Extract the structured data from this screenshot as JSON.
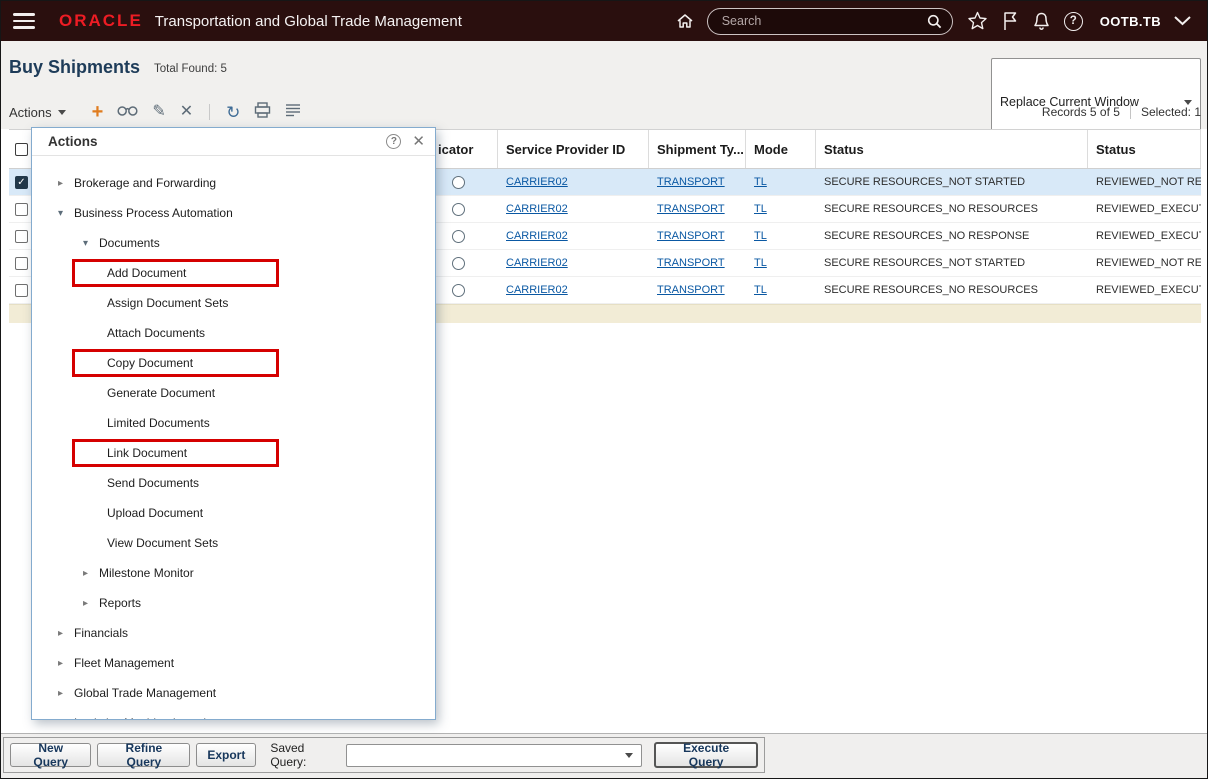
{
  "topbar": {
    "brand": "ORACLE",
    "app_title": "Transportation and Global Trade Management",
    "search_placeholder": "Search",
    "user": "OOTB.TB"
  },
  "page": {
    "title": "Buy Shipments",
    "total_found": "Total Found: 5",
    "window_select_value": "Replace Current Window"
  },
  "toolbar": {
    "actions_label": "Actions",
    "records_text": "Records 5 of 5",
    "selected_text": "Selected: 1"
  },
  "table": {
    "columns": [
      "",
      "icator",
      "Service Provider ID",
      "Shipment Ty...",
      "Mode",
      "Status",
      "Status"
    ],
    "rows": [
      {
        "selected": true,
        "service_provider_id": "CARRIER02",
        "shipment_type": "TRANSPORT",
        "mode": "TL",
        "status": "SECURE RESOURCES_NOT STARTED",
        "status2": "REVIEWED_NOT REV"
      },
      {
        "selected": false,
        "service_provider_id": "CARRIER02",
        "shipment_type": "TRANSPORT",
        "mode": "TL",
        "status": "SECURE RESOURCES_NO RESOURCES",
        "status2": "REVIEWED_EXECUTE"
      },
      {
        "selected": false,
        "service_provider_id": "CARRIER02",
        "shipment_type": "TRANSPORT",
        "mode": "TL",
        "status": "SECURE RESOURCES_NO RESPONSE",
        "status2": "REVIEWED_EXECUTE"
      },
      {
        "selected": false,
        "service_provider_id": "CARRIER02",
        "shipment_type": "TRANSPORT",
        "mode": "TL",
        "status": "SECURE RESOURCES_NOT STARTED",
        "status2": "REVIEWED_NOT REV"
      },
      {
        "selected": false,
        "service_provider_id": "CARRIER02",
        "shipment_type": "TRANSPORT",
        "mode": "TL",
        "status": "SECURE RESOURCES_NO RESOURCES",
        "status2": "REVIEWED_EXECUTE"
      }
    ]
  },
  "actions_panel": {
    "title": "Actions",
    "items": [
      {
        "label": "Brokerage and Forwarding",
        "level": 1,
        "state": "collapsed"
      },
      {
        "label": "Business Process Automation",
        "level": 1,
        "state": "expanded"
      },
      {
        "label": "Documents",
        "level": 2,
        "state": "expanded"
      },
      {
        "label": "Add Document",
        "level": 3,
        "boxed": true
      },
      {
        "label": "Assign Document Sets",
        "level": 3
      },
      {
        "label": "Attach Documents",
        "level": 3
      },
      {
        "label": "Copy Document",
        "level": 3,
        "boxed": true
      },
      {
        "label": "Generate Document",
        "level": 3
      },
      {
        "label": "Limited Documents",
        "level": 3
      },
      {
        "label": "Link Document",
        "level": 3,
        "boxed": true
      },
      {
        "label": "Send Documents",
        "level": 3
      },
      {
        "label": "Upload Document",
        "level": 3
      },
      {
        "label": "View Document Sets",
        "level": 3
      },
      {
        "label": "Milestone Monitor",
        "level": 2,
        "state": "collapsed"
      },
      {
        "label": "Reports",
        "level": 2,
        "state": "collapsed"
      },
      {
        "label": "Financials",
        "level": 1,
        "state": "collapsed"
      },
      {
        "label": "Fleet Management",
        "level": 1,
        "state": "collapsed"
      },
      {
        "label": "Global Trade Management",
        "level": 1,
        "state": "collapsed"
      },
      {
        "label": "Logistics Machine Learning",
        "level": 1,
        "state": "collapsed"
      }
    ]
  },
  "footer": {
    "new_query": "New Query",
    "refine_query": "Refine Query",
    "export": "Export",
    "saved_query_label": "Saved Query:",
    "saved_query_value": "",
    "execute_query": "Execute Query"
  },
  "colors": {
    "topbar_bg": "#2a0f0e",
    "oracle_red": "#ed1c24",
    "link_blue": "#0a58a3",
    "selected_row": "#d8e9f8",
    "annotation_red": "#d50000",
    "strip_tan": "#f2ecd6"
  }
}
